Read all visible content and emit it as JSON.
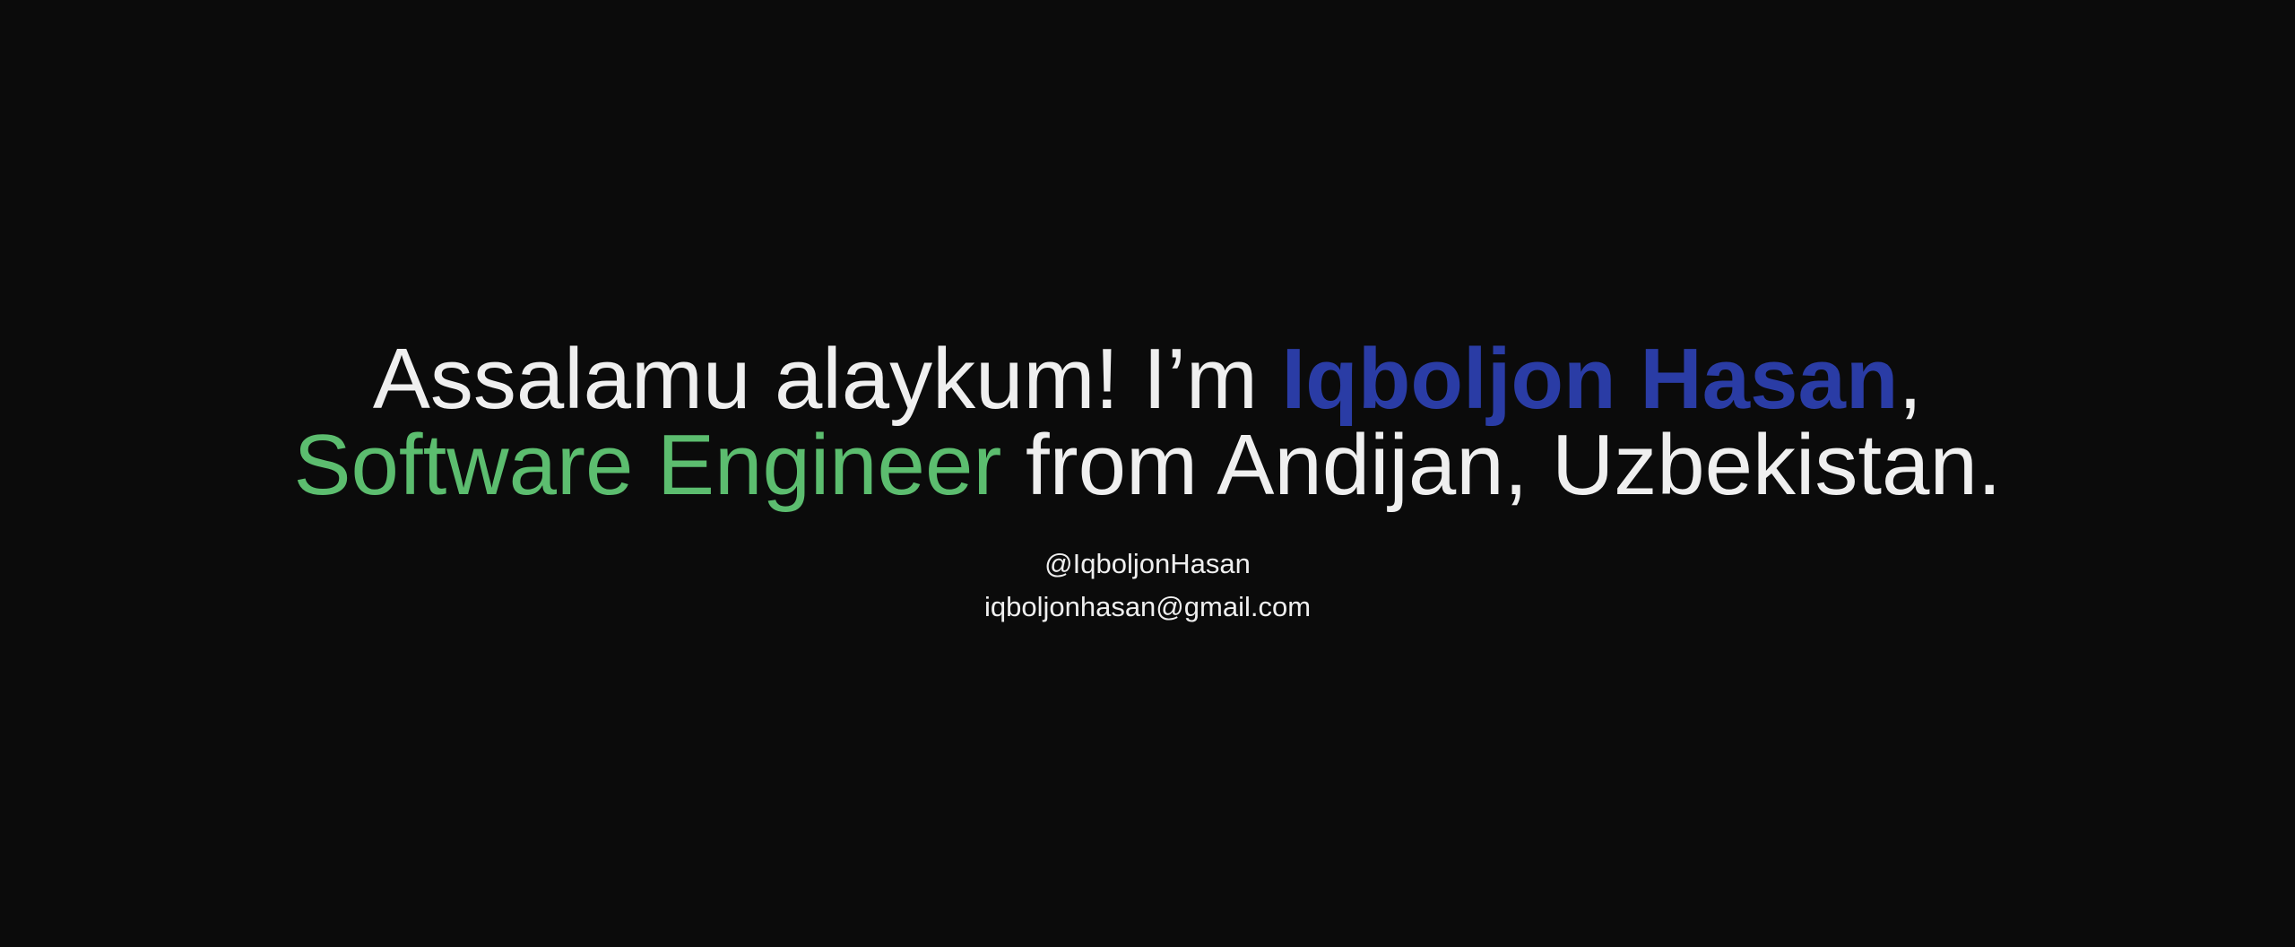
{
  "hero": {
    "line1": {
      "greeting": "Assalamu alaykum! I’m ",
      "name": "Iqboljon Hasan",
      "punctuation": ","
    },
    "line2": {
      "role": "Software Engineer",
      "rest": " from Andijan, Uzbekistan."
    }
  },
  "contacts": {
    "handle": "@IqboljonHasan",
    "email": "iqboljonhasan@gmail.com"
  },
  "colors": {
    "background": "#0b0b0b",
    "text": "#efefef",
    "name_accent": "#2a3ca5",
    "role_accent": "#5cbd6f"
  }
}
